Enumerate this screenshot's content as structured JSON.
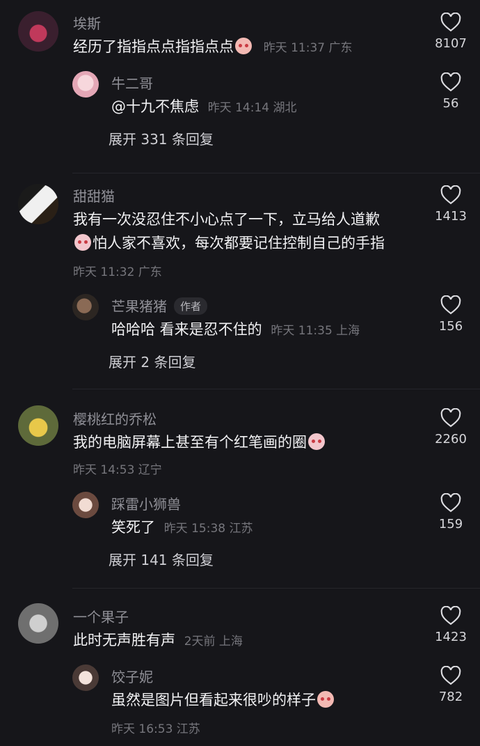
{
  "comments": [
    {
      "user": "埃斯",
      "text": "经历了指指点点指指点点",
      "meta": "昨天 11:37 广东",
      "likes": "8107",
      "reply": {
        "user": "牛二哥",
        "text": "@十九不焦虑",
        "meta": "昨天 14:14 湖北",
        "likes": "56"
      },
      "expand": "展开 331 条回复"
    },
    {
      "user": "甜甜猫",
      "text_line1": "我有一次没忍住不小心点了一下，立马给人道歉",
      "text_line2": "怕人家不喜欢，每次都要记住控制自己的手指",
      "meta": "昨天 11:32 广东",
      "likes": "1413",
      "reply": {
        "user": "芒果猪猪",
        "author_tag": "作者",
        "text": "哈哈哈 看来是忍不住的",
        "meta": "昨天 11:35 上海",
        "likes": "156"
      },
      "expand": "展开 2 条回复"
    },
    {
      "user": "樱桃红的乔松",
      "text": "我的电脑屏幕上甚至有个红笔画的圈",
      "meta": "昨天 14:53 辽宁",
      "likes": "2260",
      "reply": {
        "user": "踩雷小狮兽",
        "text": "笑死了",
        "meta": "昨天 15:38 江苏",
        "likes": "159"
      },
      "expand": "展开 141 条回复"
    },
    {
      "user": "一个果子",
      "text": "此时无声胜有声",
      "meta": "2天前 上海",
      "likes": "1423",
      "reply": {
        "user": "饺子妮",
        "text": "虽然是图片但看起来很吵的样子",
        "meta": "昨天 16:53 江苏",
        "likes": "782"
      }
    }
  ],
  "icons": {
    "like": "heart-outline-icon",
    "emoji_blush": "blushing-face-emoji",
    "emoji_cry": "crying-face-emoji"
  }
}
